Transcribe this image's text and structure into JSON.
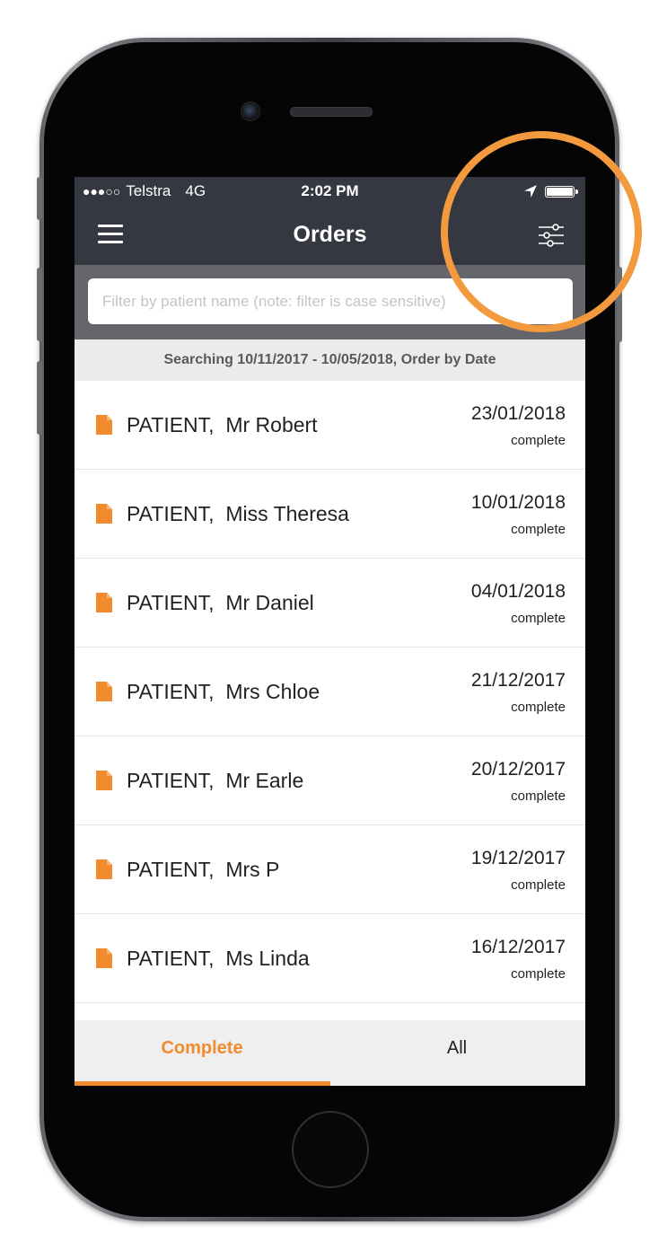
{
  "status_bar": {
    "signal": "●●●○○",
    "carrier": "Telstra",
    "network": "4G",
    "time": "2:02 PM",
    "location_icon": "location-arrow-icon",
    "battery_icon": "battery-icon",
    "battery_level": 1.0
  },
  "nav": {
    "title": "Orders",
    "menu_icon": "hamburger-menu-icon",
    "filter_icon": "filter-sliders-icon"
  },
  "search": {
    "placeholder": "Filter by patient name (note: filter is case sensitive)",
    "value": ""
  },
  "search_info": "Searching 10/11/2017 - 10/05/2018, Order by Date",
  "orders": [
    {
      "name": "PATIENT,  Mr Robert",
      "date": "23/01/2018",
      "status": "complete"
    },
    {
      "name": "PATIENT,  Miss Theresa",
      "date": "10/01/2018",
      "status": "complete"
    },
    {
      "name": "PATIENT,  Mr Daniel",
      "date": "04/01/2018",
      "status": "complete"
    },
    {
      "name": "PATIENT,  Mrs Chloe",
      "date": "21/12/2017",
      "status": "complete"
    },
    {
      "name": "PATIENT,  Mr Earle",
      "date": "20/12/2017",
      "status": "complete"
    },
    {
      "name": "PATIENT,  Mrs P",
      "date": "19/12/2017",
      "status": "complete"
    },
    {
      "name": "PATIENT,  Ms Linda",
      "date": "16/12/2017",
      "status": "complete"
    }
  ],
  "tabs": [
    {
      "label": "Complete",
      "active": true
    },
    {
      "label": "All",
      "active": false
    }
  ],
  "colors": {
    "accent": "#f28a2e",
    "header_bg": "#353840",
    "search_bg": "#64666c",
    "highlight_ring": "#f39a3e"
  }
}
